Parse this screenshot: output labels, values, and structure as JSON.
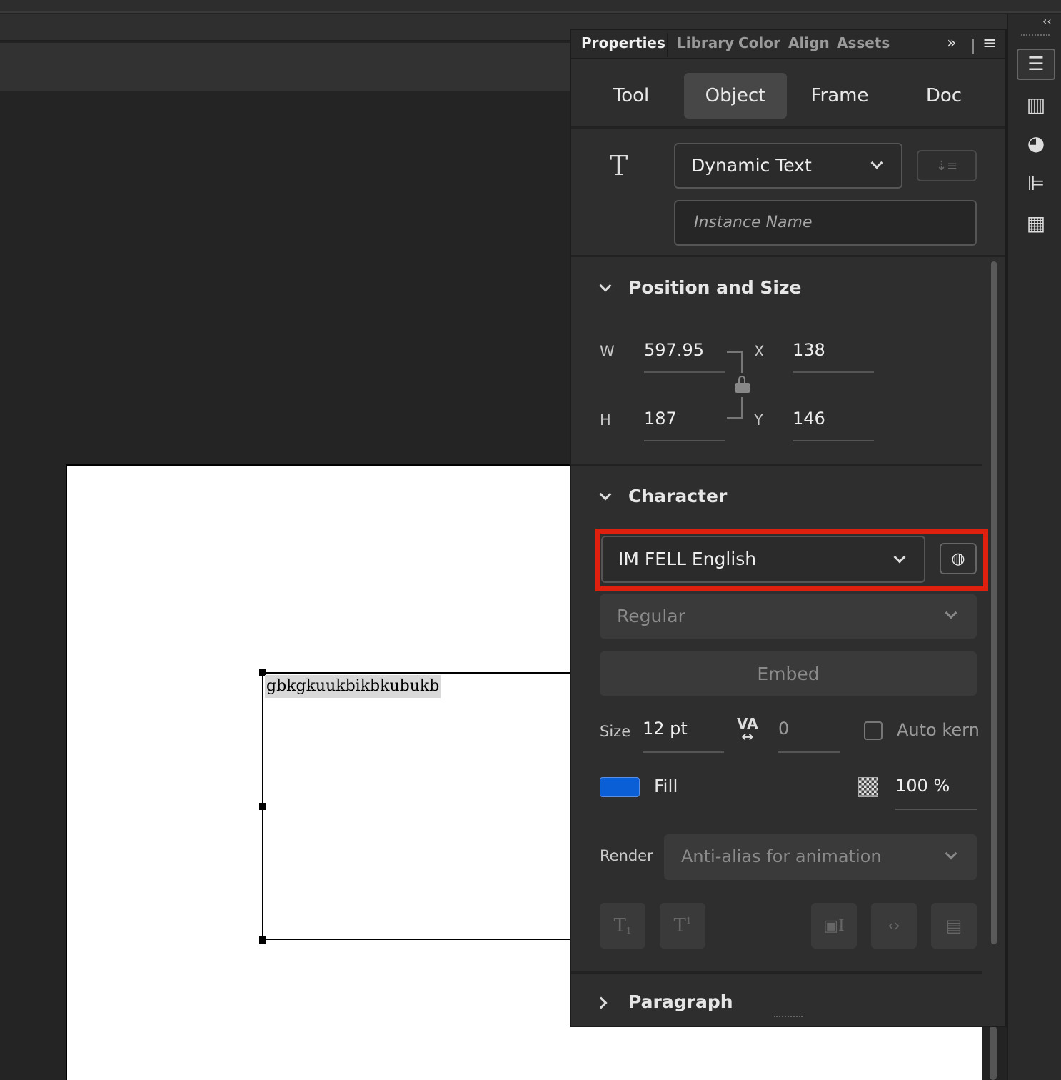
{
  "panel": {
    "tabs": [
      {
        "label": "Properties",
        "active": true
      },
      {
        "label": "Library"
      },
      {
        "label": "Color"
      },
      {
        "label": "Align"
      },
      {
        "label": "Assets"
      }
    ],
    "subtabs": [
      {
        "label": "Tool"
      },
      {
        "label": "Object",
        "selected": true
      },
      {
        "label": "Frame"
      },
      {
        "label": "Doc"
      }
    ],
    "text_type": "Dynamic Text",
    "instance_name_placeholder": "Instance Name",
    "position": {
      "title": "Position and Size",
      "w_label": "W",
      "w": "597.95",
      "x_label": "X",
      "x": "138",
      "h_label": "H",
      "h": "187",
      "y_label": "Y",
      "y": "146"
    },
    "character": {
      "title": "Character",
      "font": "IM FELL English",
      "style": "Regular",
      "embed": "Embed",
      "size_label": "Size",
      "size": "12 pt",
      "tracking": "0",
      "autokern_label": "Auto kern",
      "fill_label": "Fill",
      "fill_color": "#0a5fd6",
      "alpha": "100 %",
      "render_label": "Render",
      "render": "Anti-alias for animation"
    },
    "paragraph": {
      "title": "Paragraph"
    }
  },
  "stage": {
    "text": "gbkgkuukbikbkubukb"
  },
  "highlight_color": "#e0200f"
}
